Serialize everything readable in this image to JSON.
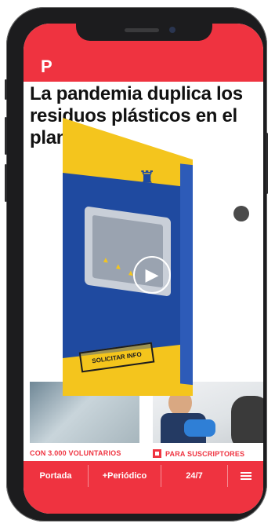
{
  "colors": {
    "brand": "#ef3340",
    "ad_yellow": "#f4c51d",
    "ad_blue": "#1f4aa0"
  },
  "header": {
    "logo_text": "P"
  },
  "article": {
    "headline": "La pandemia duplica los residuos plásticos en el planeta"
  },
  "ad": {
    "cta_label": "SOLICITAR INFO",
    "play_icon": "play-icon",
    "brand_icon": "post-horn-icon"
  },
  "cards": [
    {
      "tag": "CON 3.000 VOLUNTARIOS"
    },
    {
      "tag": "PARA SUSCRIPTORES",
      "icon": "subscriber-icon"
    }
  ],
  "bottom_nav": {
    "items": [
      {
        "label": "Portada"
      },
      {
        "label": "+Periódico"
      },
      {
        "label": "24/7"
      }
    ],
    "menu_icon": "hamburger-menu-icon"
  }
}
